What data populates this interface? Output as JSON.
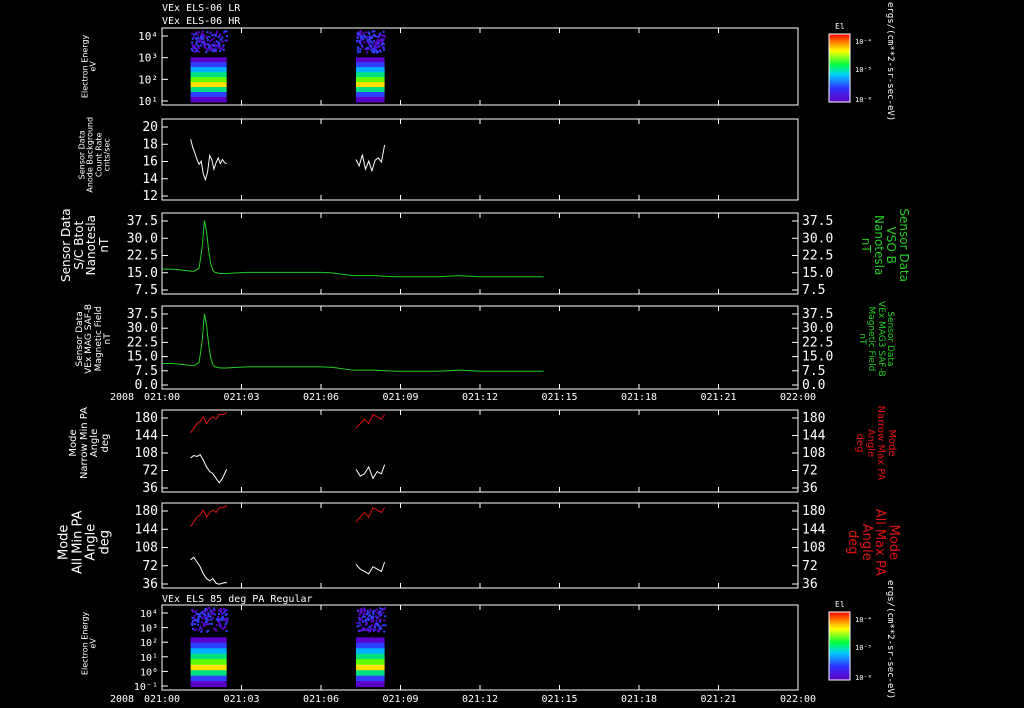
{
  "header": {
    "line1": "VEx ELS-06 LR",
    "line2": "VEx ELS-06 HR"
  },
  "time_axis": {
    "year": "2008",
    "ticks": [
      "021:00",
      "021:03",
      "021:06",
      "021:09",
      "021:12",
      "021:15",
      "021:18",
      "021:21",
      "022:00"
    ]
  },
  "colorbar": {
    "title": "El",
    "ticks": [
      "10⁻⁴",
      "10⁻⁵",
      "10⁻⁶"
    ],
    "unit": "ergs/(cm**2-sr-sec-eV)"
  },
  "panels": {
    "p1": {
      "ylabel": "Electron Energy\neV",
      "yticks": [
        "10⁴",
        "10³",
        "10²",
        "10¹"
      ]
    },
    "p2": {
      "ylabel": "Sensor Data\nAnode Background\nCount Rate\ncnts/sec",
      "yticks": [
        "20",
        "18",
        "16",
        "14",
        "12"
      ]
    },
    "p3": {
      "ylabel": "Sensor Data\nS/C Btot\nNanotesla\nnT",
      "ylabel_right": "Sensor Data\nVSO B\nNanotesla\nnT",
      "yticks": [
        "37.5",
        "30.0",
        "22.5",
        "15.0",
        "7.5"
      ]
    },
    "p4": {
      "ylabel": "Sensor Data\nVEx MAG SAF-B\nMagnetic Field\nnT",
      "ylabel_right": "Sensor Data\nVEx MAG3 SAF-B\nMagnetic Field\nnT",
      "yticks": [
        "37.5",
        "30.0",
        "22.5",
        "15.0",
        "7.5",
        "0.0"
      ]
    },
    "p5": {
      "ylabel": "Mode\nNarrow Min PA\nAngle\ndeg",
      "ylabel_right": "Mode\nNarrow Max PA\nAngle\ndeg",
      "yticks": [
        "180",
        "144",
        "108",
        "72",
        "36"
      ]
    },
    "p6": {
      "ylabel": "Mode\nAll Min PA\nAngle\ndeg",
      "ylabel_right": "Mode\nAll Max PA\nAngle\ndeg",
      "yticks": [
        "180",
        "144",
        "108",
        "72",
        "36"
      ]
    },
    "p7": {
      "title": "VEx ELS 85 deg PA Regular",
      "ylabel": "Electron Energy\neV",
      "yticks": [
        "10⁴",
        "10³",
        "10²",
        "10¹",
        "10⁰",
        "10⁻¹"
      ]
    }
  },
  "colors": {
    "white": "#ffffff",
    "green": "#22cc22",
    "red": "#dd1111"
  },
  "chart_data": [
    {
      "type": "heatmap",
      "panel": "p1",
      "ylim": [
        1,
        10000
      ],
      "log_scale": true,
      "data_intervals_min": [
        [
          2.7,
          6.1
        ],
        [
          18.3,
          21.0
        ]
      ]
    },
    {
      "type": "line",
      "panel": "p2",
      "ylim": [
        10,
        20
      ],
      "series": [
        {
          "color": "#ffffff",
          "x": [
            2.7,
            2.9,
            3.1,
            3.3,
            3.5,
            3.7,
            3.9,
            4.1,
            4.3,
            4.5,
            4.7,
            4.9,
            5.1,
            5.3,
            5.5,
            5.7,
            5.9,
            6.1,
            18.3,
            18.6,
            18.9,
            19.2,
            19.5,
            19.8,
            20.1,
            20.4,
            20.7,
            21.0
          ],
          "y": [
            17.5,
            16.5,
            15.8,
            15.0,
            14.4,
            14.8,
            13.2,
            12.5,
            13.5,
            15.5,
            15.0,
            13.8,
            14.6,
            15.2,
            14.5,
            15.0,
            14.6,
            14.5,
            15.0,
            14.2,
            15.6,
            13.8,
            14.8,
            13.6,
            14.9,
            15.2,
            14.7,
            16.8
          ]
        }
      ]
    },
    {
      "type": "line",
      "panel": "p3",
      "ylim": [
        0,
        37.5
      ],
      "series": [
        {
          "color": "#22cc22",
          "x": [
            0,
            1,
            2,
            3,
            3.5,
            3.8,
            4.0,
            4.2,
            4.4,
            4.6,
            4.8,
            5.0,
            5.5,
            6,
            8,
            10,
            12,
            14,
            15,
            16,
            18,
            20,
            22,
            24,
            26,
            28,
            30,
            32,
            34,
            36
          ],
          "y": [
            11.5,
            11.5,
            11,
            10.5,
            12,
            22,
            34,
            29,
            20,
            14,
            11,
            10,
            9.5,
            9.5,
            10,
            10,
            10,
            10,
            10,
            9.8,
            8.5,
            8.5,
            8,
            8,
            8,
            8.5,
            8,
            8,
            8,
            8
          ]
        }
      ]
    },
    {
      "type": "line",
      "panel": "p4",
      "ylim": [
        0,
        37.5
      ],
      "series": [
        {
          "color": "#22cc22",
          "x": [
            0,
            1,
            2,
            3,
            3.5,
            3.8,
            4.0,
            4.2,
            4.4,
            4.6,
            4.8,
            5.0,
            5.5,
            6,
            8,
            10,
            12,
            14,
            15,
            16,
            18,
            20,
            22,
            24,
            26,
            28,
            30,
            32,
            34,
            36
          ],
          "y": [
            11.5,
            11.5,
            11,
            10.5,
            12,
            22,
            34,
            29,
            20,
            14,
            11,
            10,
            9.5,
            9.5,
            10,
            10,
            10,
            10,
            10,
            9.8,
            8.5,
            8.5,
            8,
            8,
            8,
            8.5,
            8,
            8,
            8,
            8
          ]
        }
      ]
    },
    {
      "type": "line",
      "panel": "p5",
      "ylim": [
        0,
        180
      ],
      "series": [
        {
          "name": "Max PA",
          "color": "#dd1111",
          "x": [
            2.7,
            3.0,
            3.3,
            3.6,
            3.9,
            4.2,
            4.5,
            4.8,
            5.1,
            5.4,
            5.7,
            6.0,
            6.1,
            18.3,
            18.7,
            19.1,
            19.5,
            19.9,
            20.3,
            20.7,
            21.0
          ],
          "y": [
            130,
            140,
            150,
            155,
            165,
            150,
            160,
            165,
            160,
            170,
            170,
            172,
            175,
            140,
            150,
            160,
            150,
            170,
            165,
            160,
            170
          ]
        },
        {
          "name": "Min PA",
          "color": "#ffffff",
          "x": [
            2.7,
            3.0,
            3.3,
            3.6,
            3.9,
            4.2,
            4.5,
            4.8,
            5.1,
            5.4,
            5.7,
            6.0,
            6.1,
            18.3,
            18.7,
            19.1,
            19.5,
            19.9,
            20.3,
            20.7,
            21.0
          ],
          "y": [
            75,
            80,
            78,
            82,
            70,
            55,
            45,
            40,
            30,
            20,
            30,
            45,
            50,
            50,
            35,
            40,
            55,
            30,
            45,
            40,
            60
          ]
        }
      ]
    },
    {
      "type": "line",
      "panel": "p6",
      "ylim": [
        0,
        180
      ],
      "series": [
        {
          "name": "Max PA",
          "color": "#dd1111",
          "x": [
            2.7,
            3.0,
            3.3,
            3.6,
            3.9,
            4.2,
            4.5,
            4.8,
            5.1,
            5.4,
            5.7,
            6.0,
            6.1,
            18.3,
            18.7,
            19.1,
            19.5,
            19.9,
            20.3,
            20.7,
            21.0
          ],
          "y": [
            130,
            140,
            150,
            155,
            165,
            150,
            160,
            165,
            160,
            170,
            170,
            172,
            175,
            140,
            150,
            160,
            150,
            170,
            165,
            160,
            170
          ]
        },
        {
          "name": "Min PA",
          "color": "#ffffff",
          "x": [
            2.7,
            3.0,
            3.3,
            3.6,
            3.9,
            4.2,
            4.5,
            4.8,
            5.1,
            5.4,
            5.7,
            6.0,
            6.1,
            18.3,
            18.7,
            19.1,
            19.5,
            19.9,
            20.3,
            20.7,
            21.0
          ],
          "y": [
            60,
            65,
            55,
            45,
            30,
            20,
            15,
            20,
            10,
            8,
            10,
            12,
            10,
            50,
            40,
            35,
            30,
            45,
            40,
            35,
            55
          ]
        }
      ]
    },
    {
      "type": "heatmap",
      "panel": "p7",
      "ylim": [
        0.1,
        10000
      ],
      "log_scale": true,
      "data_intervals_min": [
        [
          2.7,
          6.1
        ],
        [
          18.3,
          21.0
        ]
      ]
    }
  ]
}
